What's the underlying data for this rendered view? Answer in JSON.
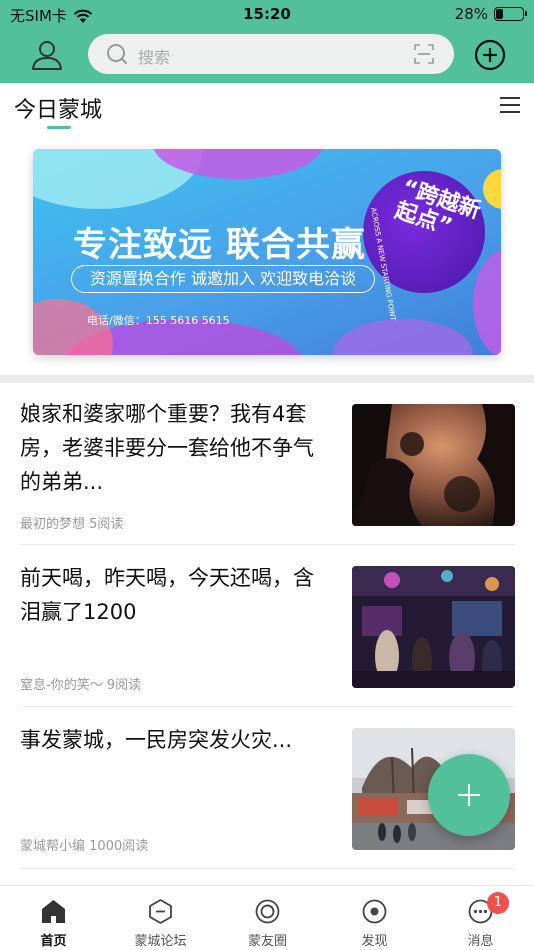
{
  "status_bar": {
    "carrier": "无SIM卡",
    "time": "15:20",
    "battery": "28%",
    "battery_level": 0.28
  },
  "header": {
    "search_placeholder": "搜索"
  },
  "section": {
    "title": "今日蒙城"
  },
  "banner": {
    "headline": "专注致远 联合共赢",
    "pill_text": "资源置换合作 诚邀加入 欢迎致电洽谈",
    "contact": "电话/微信：155 5616 5615",
    "brand_cn": "“跨越新起点”",
    "brand_en": "ACROSS A NEW STARTING POINT"
  },
  "news": [
    {
      "title": "娘家和婆家哪个重要？我有4套房，老婆非要分一套给他不争气的弟弟...",
      "meta": "最初的梦想 5阅读",
      "thumb": "sunset-trees"
    },
    {
      "title": "前天喝，昨天喝，今天还喝，含泪赢了1200",
      "meta": "窒息-你的笑～ 9阅读",
      "thumb": "nightclub"
    },
    {
      "title": "事发蒙城，一民房突发火灾...",
      "meta": "蒙城帮小编 1000阅读",
      "thumb": "street-fire"
    }
  ],
  "tabbar": {
    "tabs": [
      {
        "label": "首页",
        "icon": "home-icon",
        "active": true
      },
      {
        "label": "蒙城论坛",
        "icon": "forum-icon",
        "active": false
      },
      {
        "label": "蒙友圈",
        "icon": "circle-icon",
        "active": false
      },
      {
        "label": "发现",
        "icon": "discover-icon",
        "active": false
      },
      {
        "label": "消息",
        "icon": "message-icon",
        "active": false,
        "badge": "1"
      }
    ]
  },
  "colors": {
    "brand_green": "#52c19b",
    "badge_red": "#f2504a"
  }
}
